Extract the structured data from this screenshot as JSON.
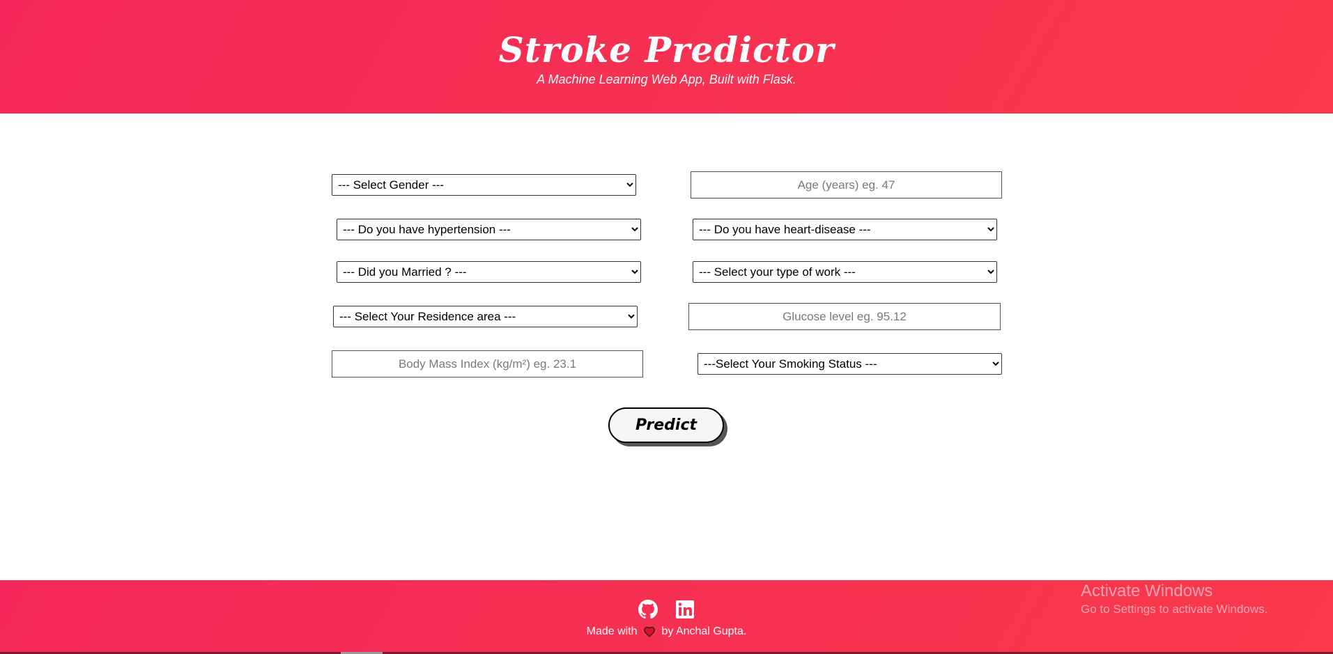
{
  "header": {
    "title": "Stroke Predictor",
    "subtitle": "A Machine Learning Web App, Built with Flask."
  },
  "form": {
    "gender_select": "--- Select Gender ---",
    "age_placeholder": "Age (years) eg. 47",
    "hypertension_select": "--- Do you have hypertension ---",
    "heart_disease_select": "--- Do you have heart-disease ---",
    "married_select": "--- Did you Married ? ---",
    "work_type_select": "--- Select your type of work ---",
    "residence_select": "--- Select Your Residence area ---",
    "glucose_placeholder": "Glucose level eg. 95.12",
    "bmi_placeholder": "Body Mass Index (kg/m²) eg. 23.1",
    "smoking_select": "---Select Your Smoking Status ---",
    "predict_label": "Predict"
  },
  "footer": {
    "icons": [
      "github-icon",
      "linkedin-icon",
      "heart-icon"
    ],
    "made_with": "Made with",
    "by": "by Anchal Gupta."
  },
  "watermark": {
    "title": "Activate Windows",
    "subtitle": "Go to Settings to activate Windows."
  },
  "colors": {
    "accent_start": "#f5275a",
    "accent_end": "#f83a4b"
  }
}
